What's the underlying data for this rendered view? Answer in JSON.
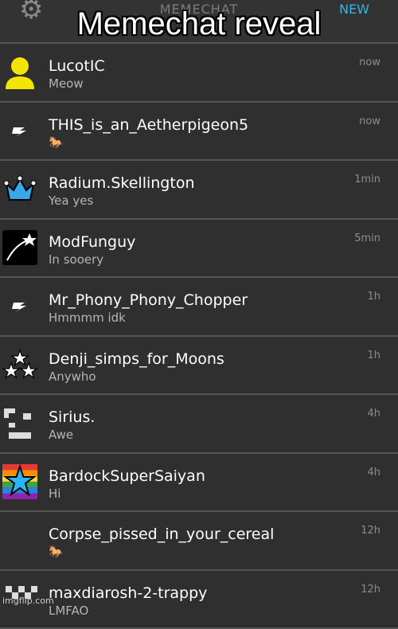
{
  "app": {
    "title": "MEMECHAT",
    "new_label": "NEW",
    "settings_icon": "gear-icon"
  },
  "caption": "Memechat reveal",
  "chats": [
    {
      "name": "LucotIC",
      "message": "Meow",
      "time": "now",
      "avatar_icon": "yellow-person-icon"
    },
    {
      "name": "THIS_is_an_Aetherpigeon5",
      "message": "🐎",
      "time": "now",
      "avatar_icon": "slash-logo-icon"
    },
    {
      "name": "Radium.Skellington",
      "message": "Yea yes",
      "time": "1min",
      "avatar_icon": "crown-icon"
    },
    {
      "name": "ModFunguy",
      "message": "In sooery",
      "time": "5min",
      "avatar_icon": "shooting-star-icon"
    },
    {
      "name": "Mr_Phony_Phony_Chopper",
      "message": "Hmmmm idk",
      "time": "1h",
      "avatar_icon": "slash-logo-icon"
    },
    {
      "name": "Denji_simps_for_Moons",
      "message": "Anywho",
      "time": "1h",
      "avatar_icon": "three-stars-icon"
    },
    {
      "name": "Sirius.",
      "message": "Awe",
      "time": "4h",
      "avatar_icon": "pixel-blocks-icon"
    },
    {
      "name": "BardockSuperSaiyan",
      "message": "Hi",
      "time": "4h",
      "avatar_icon": "rainbow-star-icon"
    },
    {
      "name": "Corpse_pissed_in_your_cereal",
      "message": "🐎",
      "time": "12h",
      "avatar_icon": "blank-avatar"
    },
    {
      "name": "maxdiarosh-2-trappy",
      "message": "LMFAO",
      "time": "12h",
      "avatar_icon": "checker-icon"
    }
  ],
  "watermark": "imgflip.com",
  "colors": {
    "background": "#2f2f2f",
    "divider": "#555555",
    "accent": "#33b5e5",
    "crown": "#39a8e8",
    "person": "#f2e600"
  }
}
